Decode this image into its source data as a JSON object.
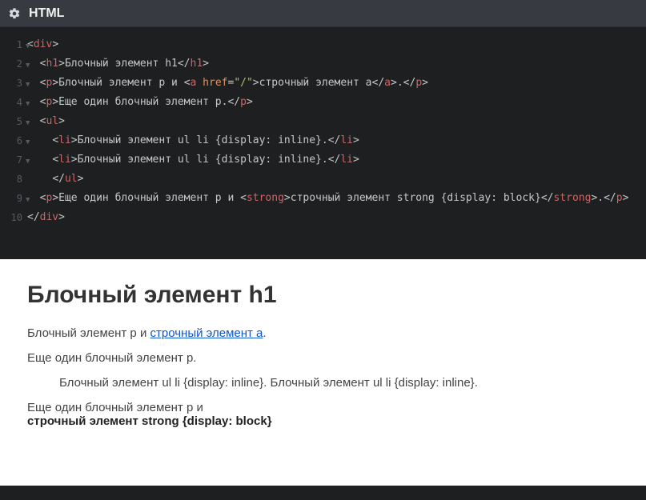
{
  "header": {
    "title": "HTML"
  },
  "code": {
    "lines": [
      {
        "num": "1",
        "arrow": true,
        "indent": 0,
        "tokens": [
          {
            "c": "t-punc",
            "t": "<"
          },
          {
            "c": "t-tag",
            "t": "div"
          },
          {
            "c": "t-punc",
            "t": ">"
          }
        ]
      },
      {
        "num": "2",
        "arrow": true,
        "indent": 1,
        "tokens": [
          {
            "c": "t-punc",
            "t": "<"
          },
          {
            "c": "t-tag",
            "t": "h1"
          },
          {
            "c": "t-punc",
            "t": ">"
          },
          {
            "c": "t-text",
            "t": "Блочный элемент h1"
          },
          {
            "c": "t-punc",
            "t": "</"
          },
          {
            "c": "t-tag",
            "t": "h1"
          },
          {
            "c": "t-punc",
            "t": ">"
          }
        ]
      },
      {
        "num": "3",
        "arrow": true,
        "indent": 1,
        "tokens": [
          {
            "c": "t-punc",
            "t": "<"
          },
          {
            "c": "t-tag",
            "t": "p"
          },
          {
            "c": "t-punc",
            "t": ">"
          },
          {
            "c": "t-text",
            "t": "Блочный элемент p и "
          },
          {
            "c": "t-punc",
            "t": "<"
          },
          {
            "c": "t-tag",
            "t": "a"
          },
          {
            "c": "t-text",
            "t": " "
          },
          {
            "c": "t-attr",
            "t": "href"
          },
          {
            "c": "t-punc",
            "t": "="
          },
          {
            "c": "t-str",
            "t": "\"/\""
          },
          {
            "c": "t-punc",
            "t": ">"
          },
          {
            "c": "t-text",
            "t": "строчный элемент a"
          },
          {
            "c": "t-punc",
            "t": "</"
          },
          {
            "c": "t-tag",
            "t": "a"
          },
          {
            "c": "t-punc",
            "t": ">"
          },
          {
            "c": "t-text",
            "t": "."
          },
          {
            "c": "t-punc",
            "t": "</"
          },
          {
            "c": "t-tag",
            "t": "p"
          },
          {
            "c": "t-punc",
            "t": ">"
          }
        ]
      },
      {
        "num": "4",
        "arrow": true,
        "indent": 1,
        "tokens": [
          {
            "c": "t-punc",
            "t": "<"
          },
          {
            "c": "t-tag",
            "t": "p"
          },
          {
            "c": "t-punc",
            "t": ">"
          },
          {
            "c": "t-text",
            "t": "Еще один блочный элемент p."
          },
          {
            "c": "t-punc",
            "t": "</"
          },
          {
            "c": "t-tag",
            "t": "p"
          },
          {
            "c": "t-punc",
            "t": ">"
          }
        ]
      },
      {
        "num": "5",
        "arrow": true,
        "indent": 1,
        "tokens": [
          {
            "c": "t-punc",
            "t": "<"
          },
          {
            "c": "t-tag",
            "t": "ul"
          },
          {
            "c": "t-punc",
            "t": ">"
          }
        ]
      },
      {
        "num": "6",
        "arrow": true,
        "indent": 2,
        "tokens": [
          {
            "c": "t-punc",
            "t": "<"
          },
          {
            "c": "t-tag",
            "t": "li"
          },
          {
            "c": "t-punc",
            "t": ">"
          },
          {
            "c": "t-text",
            "t": "Блочный элемент ul li {display: inline}."
          },
          {
            "c": "t-punc",
            "t": "</"
          },
          {
            "c": "t-tag",
            "t": "li"
          },
          {
            "c": "t-punc",
            "t": ">"
          }
        ]
      },
      {
        "num": "7",
        "arrow": true,
        "indent": 2,
        "tokens": [
          {
            "c": "t-punc",
            "t": "<"
          },
          {
            "c": "t-tag",
            "t": "li"
          },
          {
            "c": "t-punc",
            "t": ">"
          },
          {
            "c": "t-text",
            "t": "Блочный элемент ul li {display: inline}."
          },
          {
            "c": "t-punc",
            "t": "</"
          },
          {
            "c": "t-tag",
            "t": "li"
          },
          {
            "c": "t-punc",
            "t": ">"
          }
        ]
      },
      {
        "num": "8",
        "arrow": false,
        "indent": 2,
        "tokens": [
          {
            "c": "t-punc",
            "t": "</"
          },
          {
            "c": "t-tag",
            "t": "ul"
          },
          {
            "c": "t-punc",
            "t": ">"
          }
        ]
      },
      {
        "num": "9",
        "arrow": true,
        "indent": 1,
        "tokens": [
          {
            "c": "t-punc",
            "t": "<"
          },
          {
            "c": "t-tag",
            "t": "p"
          },
          {
            "c": "t-punc",
            "t": ">"
          },
          {
            "c": "t-text",
            "t": "Еще один блочный элемент p и "
          },
          {
            "c": "t-punc",
            "t": "<"
          },
          {
            "c": "t-tag",
            "t": "strong"
          },
          {
            "c": "t-punc",
            "t": ">"
          },
          {
            "c": "t-text",
            "t": "строчный элемент strong {display: block}"
          },
          {
            "c": "t-punc",
            "t": "</"
          },
          {
            "c": "t-tag",
            "t": "strong"
          },
          {
            "c": "t-punc",
            "t": ">"
          },
          {
            "c": "t-text",
            "t": "."
          },
          {
            "c": "t-punc",
            "t": "</"
          },
          {
            "c": "t-tag",
            "t": "p"
          },
          {
            "c": "t-punc",
            "t": ">"
          }
        ]
      },
      {
        "num": "10",
        "arrow": false,
        "indent": 0,
        "tokens": [
          {
            "c": "t-punc",
            "t": "</"
          },
          {
            "c": "t-tag",
            "t": "div"
          },
          {
            "c": "t-punc",
            "t": ">"
          }
        ]
      }
    ]
  },
  "preview": {
    "h1": "Блочный элемент h1",
    "p1_pre": "Блочный элемент p и ",
    "p1_link": "строчный элемент a",
    "p1_post": ".",
    "p2": "Еще один блочный элемент p.",
    "li1": "Блочный элемент ul li {display: inline}.",
    "li2": "Блочный элемент ul li {display: inline}.",
    "p3_pre": "Еще один блочный элемент p и ",
    "p3_strong": "строчный элемент strong {display: block}"
  }
}
